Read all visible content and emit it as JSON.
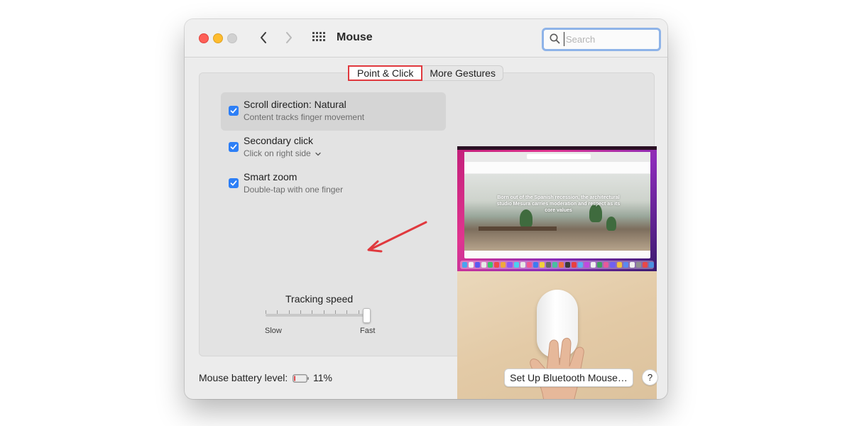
{
  "window": {
    "title": "Mouse",
    "search_placeholder": "Search"
  },
  "tabs": [
    {
      "label": "Point & Click",
      "active": true
    },
    {
      "label": "More Gestures",
      "active": false
    }
  ],
  "options": [
    {
      "title": "Scroll direction: Natural",
      "subtitle": "Content tracks finger movement",
      "checked": true,
      "selected": true
    },
    {
      "title": "Secondary click",
      "subtitle": "Click on right side",
      "checked": true,
      "selected": false,
      "has_dropdown": true
    },
    {
      "title": "Smart zoom",
      "subtitle": "Double-tap with one finger",
      "checked": true,
      "selected": false
    }
  ],
  "tracking": {
    "label": "Tracking speed",
    "min_label": "Slow",
    "max_label": "Fast",
    "tick_count": 10,
    "value_fraction": 1.0
  },
  "preview": {
    "headline": "Born out of the Spanish recession, the architectural studio Mesura carries moderation and respect as its core values"
  },
  "footer": {
    "battery_label": "Mouse battery level:",
    "battery_value": "11%",
    "bluetooth_button": "Set Up Bluetooth Mouse…",
    "help_button": "?"
  },
  "colors": {
    "accent": "#2d7ff6",
    "tab_highlight": "#e0393e",
    "annotation_arrow": "#e0393e",
    "battery_low": "#e0393e"
  },
  "icons": {
    "back": "chevron-left-icon",
    "forward": "chevron-right-icon",
    "grid": "grid-icon",
    "search": "magnifier-icon",
    "battery": "battery-icon",
    "dropdown": "chevron-down-icon"
  }
}
